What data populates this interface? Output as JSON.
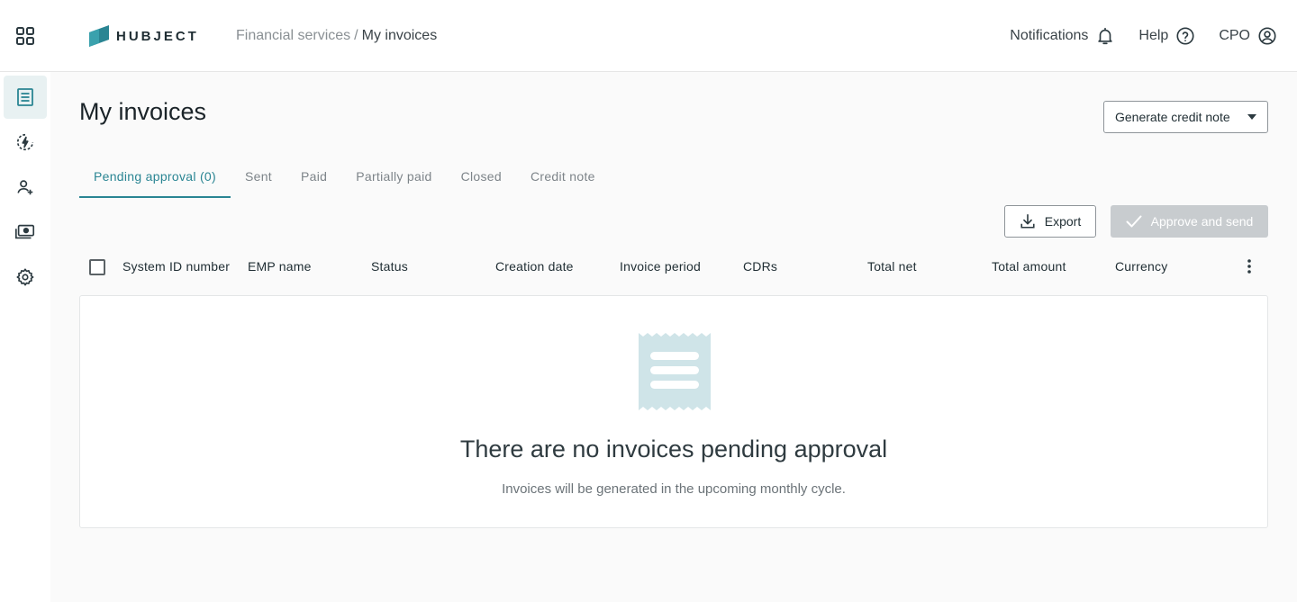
{
  "header": {
    "logo_text": "HUBJECT",
    "breadcrumb": {
      "parent": "Financial services",
      "separator": "/",
      "current": "My invoices"
    },
    "actions": [
      {
        "label": "Notifications",
        "icon": "bell-icon"
      },
      {
        "label": "Help",
        "icon": "help-circle-icon"
      },
      {
        "label": "CPO",
        "icon": "account-circle-icon"
      }
    ]
  },
  "sidebar": {
    "items": [
      {
        "name": "invoices",
        "icon": "document-list-icon",
        "active": true
      },
      {
        "name": "charging",
        "icon": "charging-bolt-icon",
        "active": false
      },
      {
        "name": "users",
        "icon": "user-add-icon",
        "active": false
      },
      {
        "name": "payments",
        "icon": "money-icon",
        "active": false
      },
      {
        "name": "settings",
        "icon": "gear-icon",
        "active": false
      }
    ]
  },
  "page": {
    "title": "My invoices",
    "generate_button": "Generate credit note"
  },
  "tabs": [
    {
      "label": "Pending approval (0)",
      "active": true
    },
    {
      "label": "Sent",
      "active": false
    },
    {
      "label": "Paid",
      "active": false
    },
    {
      "label": "Partially paid",
      "active": false
    },
    {
      "label": "Closed",
      "active": false
    },
    {
      "label": "Credit note",
      "active": false
    }
  ],
  "toolbar": {
    "export_label": "Export",
    "approve_label": "Approve and send"
  },
  "table": {
    "columns": [
      "System ID number",
      "EMP name",
      "Status",
      "Creation date",
      "Invoice period",
      "CDRs",
      "Total net",
      "Total amount",
      "Currency"
    ]
  },
  "empty_state": {
    "title": "There are no invoices pending approval",
    "subtitle": "Invoices will be generated in the upcoming monthly cycle."
  },
  "colors": {
    "accent": "#2a8593",
    "illustration": "#cfe4e8",
    "disabled": "#c8cccf"
  }
}
